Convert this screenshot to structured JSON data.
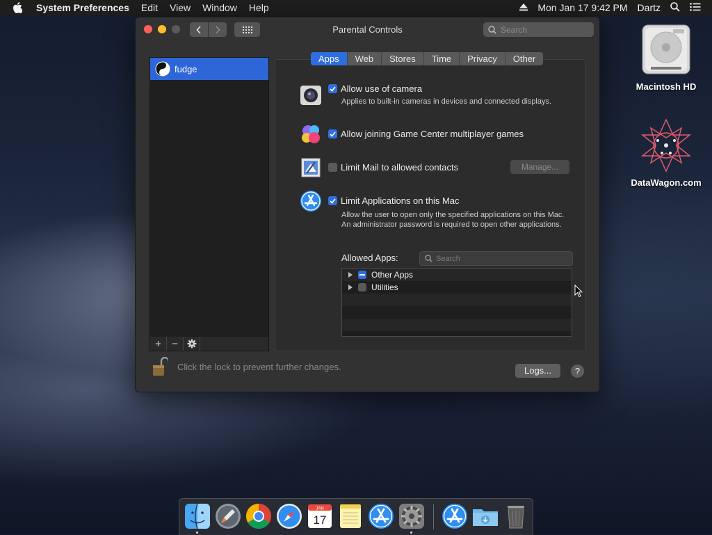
{
  "menubar": {
    "app_name": "System Preferences",
    "items": [
      "Edit",
      "View",
      "Window",
      "Help"
    ],
    "clock": "Mon Jan 17  9:42 PM",
    "user": "Dartz"
  },
  "window": {
    "title": "Parental Controls",
    "search_placeholder": "Search"
  },
  "users": [
    {
      "name": "fudge"
    }
  ],
  "tabs": [
    "Apps",
    "Web",
    "Stores",
    "Time",
    "Privacy",
    "Other"
  ],
  "active_tab": "Apps",
  "options": {
    "camera": {
      "label": "Allow use of camera",
      "desc": "Applies to built-in cameras in devices and connected displays.",
      "checked": true
    },
    "gamecenter": {
      "label": "Allow joining Game Center multiplayer games",
      "checked": true
    },
    "mail": {
      "label": "Limit Mail to allowed contacts",
      "checked": false,
      "button": "Manage..."
    },
    "apps": {
      "label": "Limit Applications on this Mac",
      "desc": "Allow the user to open only the specified applications on this Mac. An administrator password is required to open other applications.",
      "checked": true
    }
  },
  "allowed_apps": {
    "label": "Allowed Apps:",
    "search_placeholder": "Search",
    "items": [
      {
        "name": "Other Apps",
        "state": "mixed"
      },
      {
        "name": "Utilities",
        "state": "unchecked"
      }
    ]
  },
  "footer": {
    "lock_text": "Click the lock to prevent further changes.",
    "logs_button": "Logs...",
    "help": "?"
  },
  "desktop": [
    {
      "label": "Macintosh HD"
    },
    {
      "label": "DataWagon.com"
    }
  ],
  "dock": [
    "Finder",
    "Launchpad",
    "Chrome",
    "Safari",
    "Calendar",
    "Notes",
    "App Store",
    "System Preferences",
    "App Store",
    "Downloads",
    "Trash"
  ],
  "calendar_icon": {
    "month": "JAN",
    "day": "17"
  },
  "colors": {
    "accent": "#2f6ee0",
    "window_bg": "#323232"
  }
}
